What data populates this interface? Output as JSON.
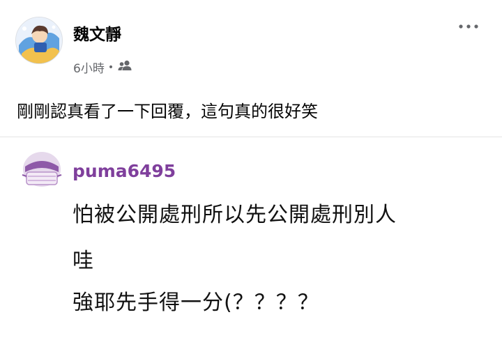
{
  "post": {
    "author": "魏文靜",
    "time": "6小時",
    "separator": "•",
    "audience_icon": "friends-icon",
    "more_icon": "more-dots-icon",
    "text": "剛剛認真看了一下回覆，這句真的很好笑"
  },
  "quoted_comment": {
    "username": "puma6495",
    "lines": [
      "怕被公開處刑所以先公開處刑別人",
      "哇",
      "強耶先手得一分(？？？？"
    ]
  },
  "colors": {
    "username_purple": "#7f3f9c",
    "meta_gray": "#65676b"
  }
}
